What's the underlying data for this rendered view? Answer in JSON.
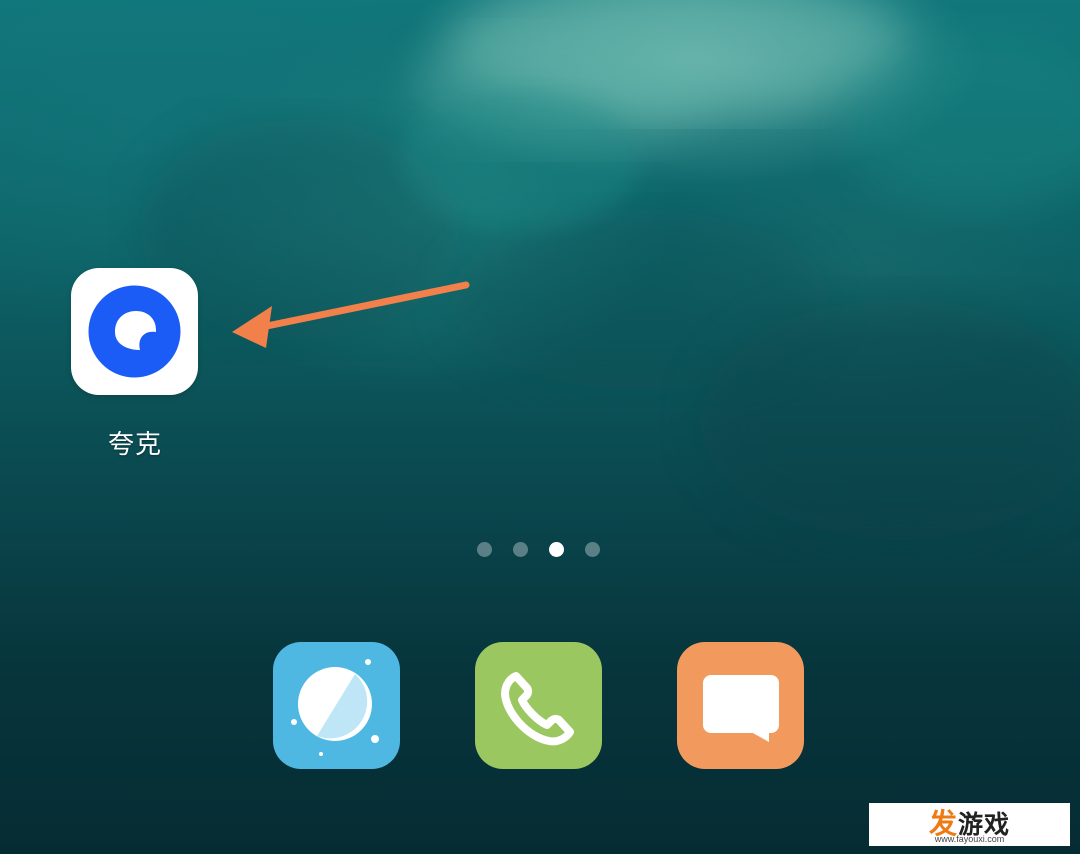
{
  "home_screen": {
    "apps": [
      {
        "label": "夸克",
        "icon": "quark-icon"
      }
    ],
    "page_indicator": {
      "total": 4,
      "active_index": 2
    },
    "annotation": {
      "type": "arrow",
      "color": "#f2804a",
      "points_to": "夸克"
    }
  },
  "dock": {
    "apps": [
      {
        "icon": "browser-icon",
        "color": "#4fb8e2"
      },
      {
        "icon": "phone-icon",
        "color": "#9bc760"
      },
      {
        "icon": "messages-icon",
        "color": "#f29a5e"
      }
    ]
  },
  "colors": {
    "quark_blue": "#1a5cf5",
    "arrow": "#f2804a"
  },
  "watermark": {
    "first_char": "发",
    "rest": "游戏",
    "url": "www.fayouxi.com"
  }
}
